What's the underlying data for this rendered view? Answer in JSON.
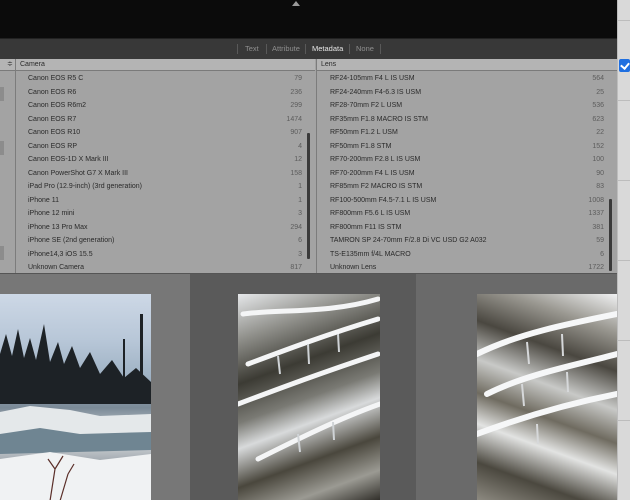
{
  "filter_bar": {
    "tabs": [
      {
        "label": "Text",
        "active": false
      },
      {
        "label": "Attribute",
        "active": false
      },
      {
        "label": "Metadata",
        "active": true
      },
      {
        "label": "None",
        "active": false
      }
    ]
  },
  "camera_column": {
    "header": "Camera",
    "rows": [
      {
        "label": "Canon EOS R5 C",
        "count": "79"
      },
      {
        "label": "Canon EOS R6",
        "count": "236"
      },
      {
        "label": "Canon EOS R6m2",
        "count": "299"
      },
      {
        "label": "Canon EOS R7",
        "count": "1474"
      },
      {
        "label": "Canon EOS R10",
        "count": "907"
      },
      {
        "label": "Canon EOS RP",
        "count": "4"
      },
      {
        "label": "Canon EOS-1D X Mark III",
        "count": "12"
      },
      {
        "label": "Canon PowerShot G7 X Mark III",
        "count": "158"
      },
      {
        "label": "iPad Pro (12.9-inch) (3rd generation)",
        "count": "1"
      },
      {
        "label": "iPhone 11",
        "count": "1"
      },
      {
        "label": "iPhone 12 mini",
        "count": "3"
      },
      {
        "label": "iPhone 13 Pro Max",
        "count": "294"
      },
      {
        "label": "iPhone SE (2nd generation)",
        "count": "6"
      },
      {
        "label": "iPhone14,3 iOS 15.5",
        "count": "3"
      },
      {
        "label": "Unknown Camera",
        "count": "817"
      }
    ]
  },
  "lens_column": {
    "header": "Lens",
    "rows": [
      {
        "label": "RF24-105mm F4 L IS USM",
        "count": "564"
      },
      {
        "label": "RF24-240mm F4-6.3 IS USM",
        "count": "25"
      },
      {
        "label": "RF28-70mm F2 L USM",
        "count": "536"
      },
      {
        "label": "RF35mm F1.8 MACRO IS STM",
        "count": "623"
      },
      {
        "label": "RF50mm F1.2 L USM",
        "count": "22"
      },
      {
        "label": "RF50mm F1.8 STM",
        "count": "152"
      },
      {
        "label": "RF70-200mm F2.8 L IS USM",
        "count": "100"
      },
      {
        "label": "RF70-200mm F4 L IS USM",
        "count": "90"
      },
      {
        "label": "RF85mm F2 MACRO IS STM",
        "count": "83"
      },
      {
        "label": "RF100-500mm F4.5-7.1 L IS USM",
        "count": "1008"
      },
      {
        "label": "RF800mm F5.6 L IS USM",
        "count": "1337"
      },
      {
        "label": "RF800mm F11 IS STM",
        "count": "381"
      },
      {
        "label": "TAMRON SP 24-70mm F/2.8 Di VC USD G2 A032",
        "count": "59"
      },
      {
        "label": "TS-E135mm f/4L MACRO",
        "count": "6"
      },
      {
        "label": "Unknown Lens",
        "count": "1722"
      }
    ]
  },
  "icons": {
    "top": "chevron-up-icon",
    "checkbox": "checkbox-checked-icon",
    "grid_zoom": "expand-icon"
  },
  "colors": {
    "accent": "#1f6fe0",
    "panel_bg": "#a3a3a3",
    "header_bg": "#b4b4b4",
    "toolbar_bg": "#383838"
  }
}
